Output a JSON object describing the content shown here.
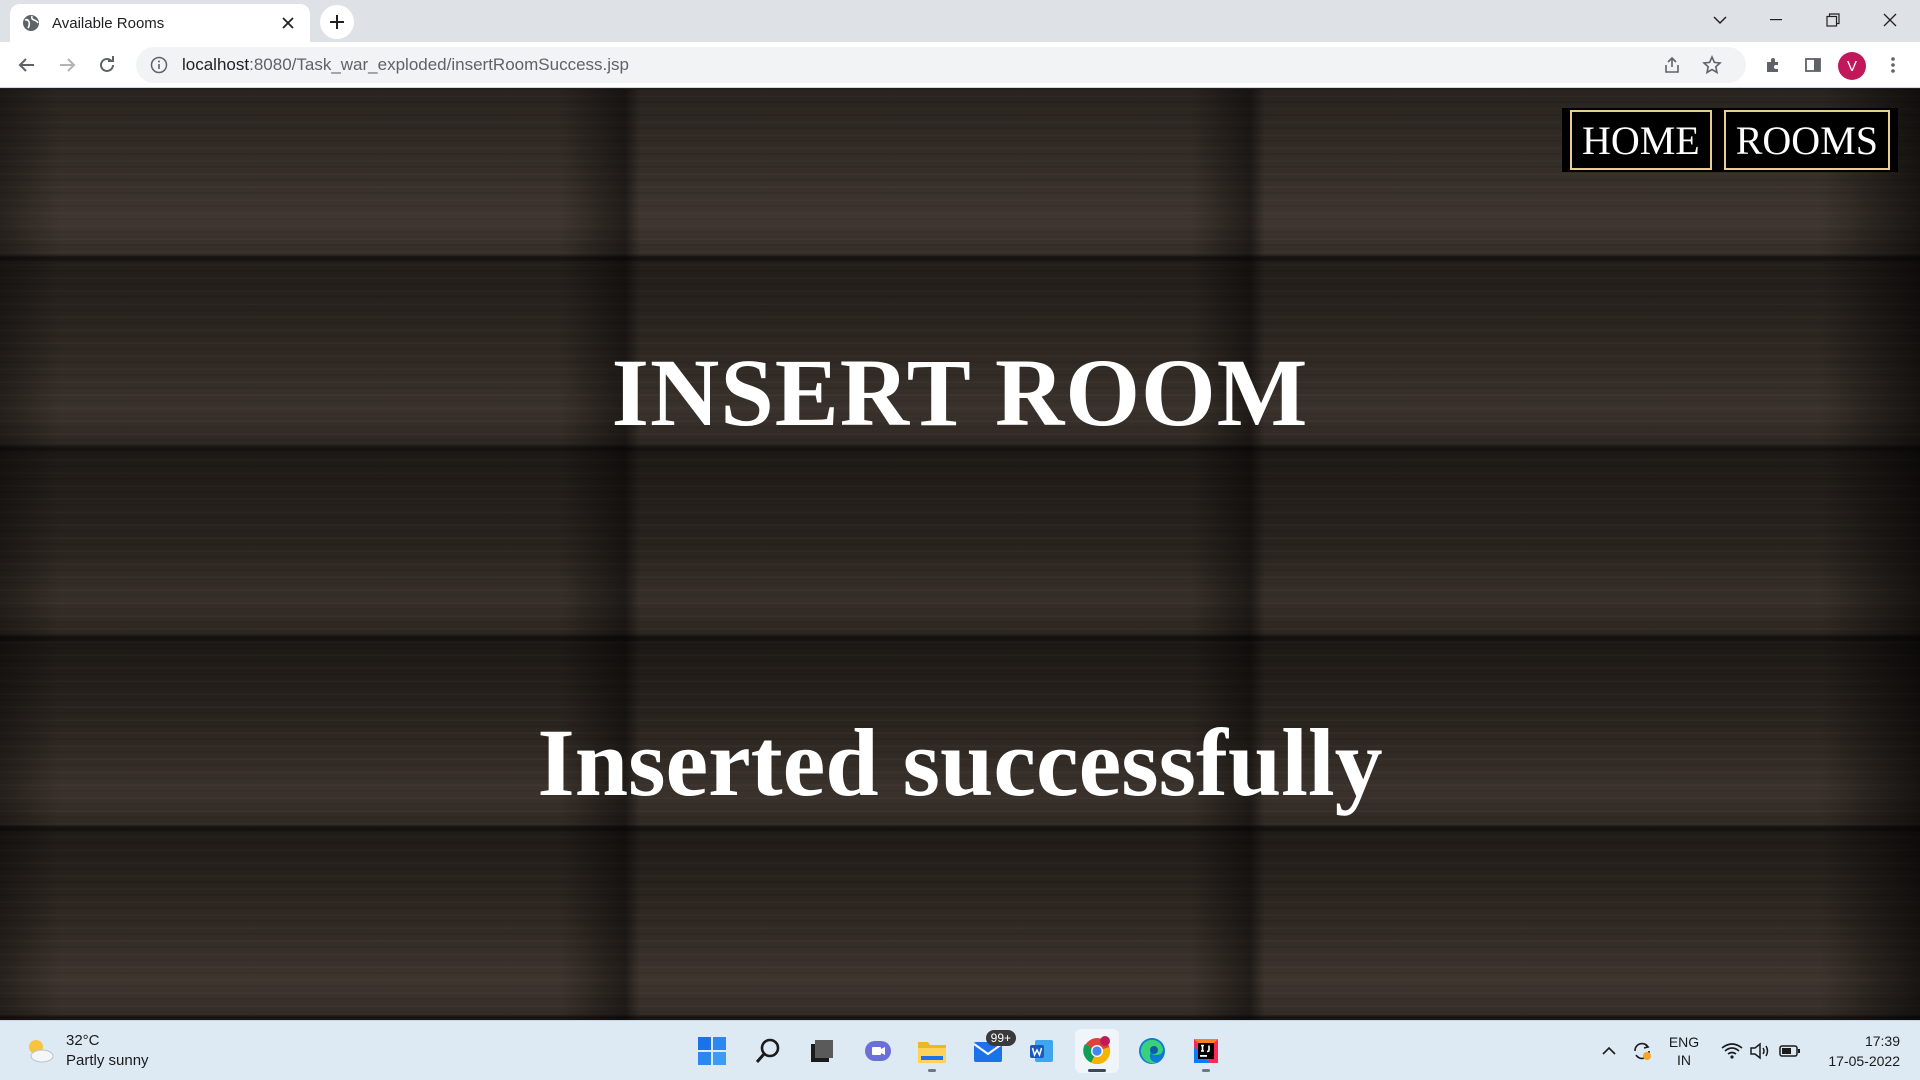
{
  "browser": {
    "tab_title": "Available Rooms",
    "url_host": "localhost",
    "url_rest": ":8080/Task_war_exploded/insertRoomSuccess.jsp",
    "profile_initial": "V",
    "profile_color": "#c2185b"
  },
  "page": {
    "nav": [
      {
        "label": "HOME"
      },
      {
        "label": "ROOMS"
      }
    ],
    "nav_border_color": "#e9cf8f",
    "heading": "INSERT ROOM",
    "message": "Inserted successfully"
  },
  "taskbar": {
    "weather": {
      "temp": "32°C",
      "condition": "Partly sunny"
    },
    "apps": [
      {
        "name": "start-icon"
      },
      {
        "name": "search-icon"
      },
      {
        "name": "task-view-icon"
      },
      {
        "name": "teams-chat-icon"
      },
      {
        "name": "file-explorer-icon"
      },
      {
        "name": "mail-icon",
        "badge": "99+"
      },
      {
        "name": "word-icon"
      },
      {
        "name": "chrome-icon"
      },
      {
        "name": "edge-icon"
      },
      {
        "name": "intellij-icon"
      }
    ],
    "language": {
      "line1": "ENG",
      "line2": "IN"
    },
    "clock": {
      "time": "17:39",
      "date": "17-05-2022"
    }
  }
}
